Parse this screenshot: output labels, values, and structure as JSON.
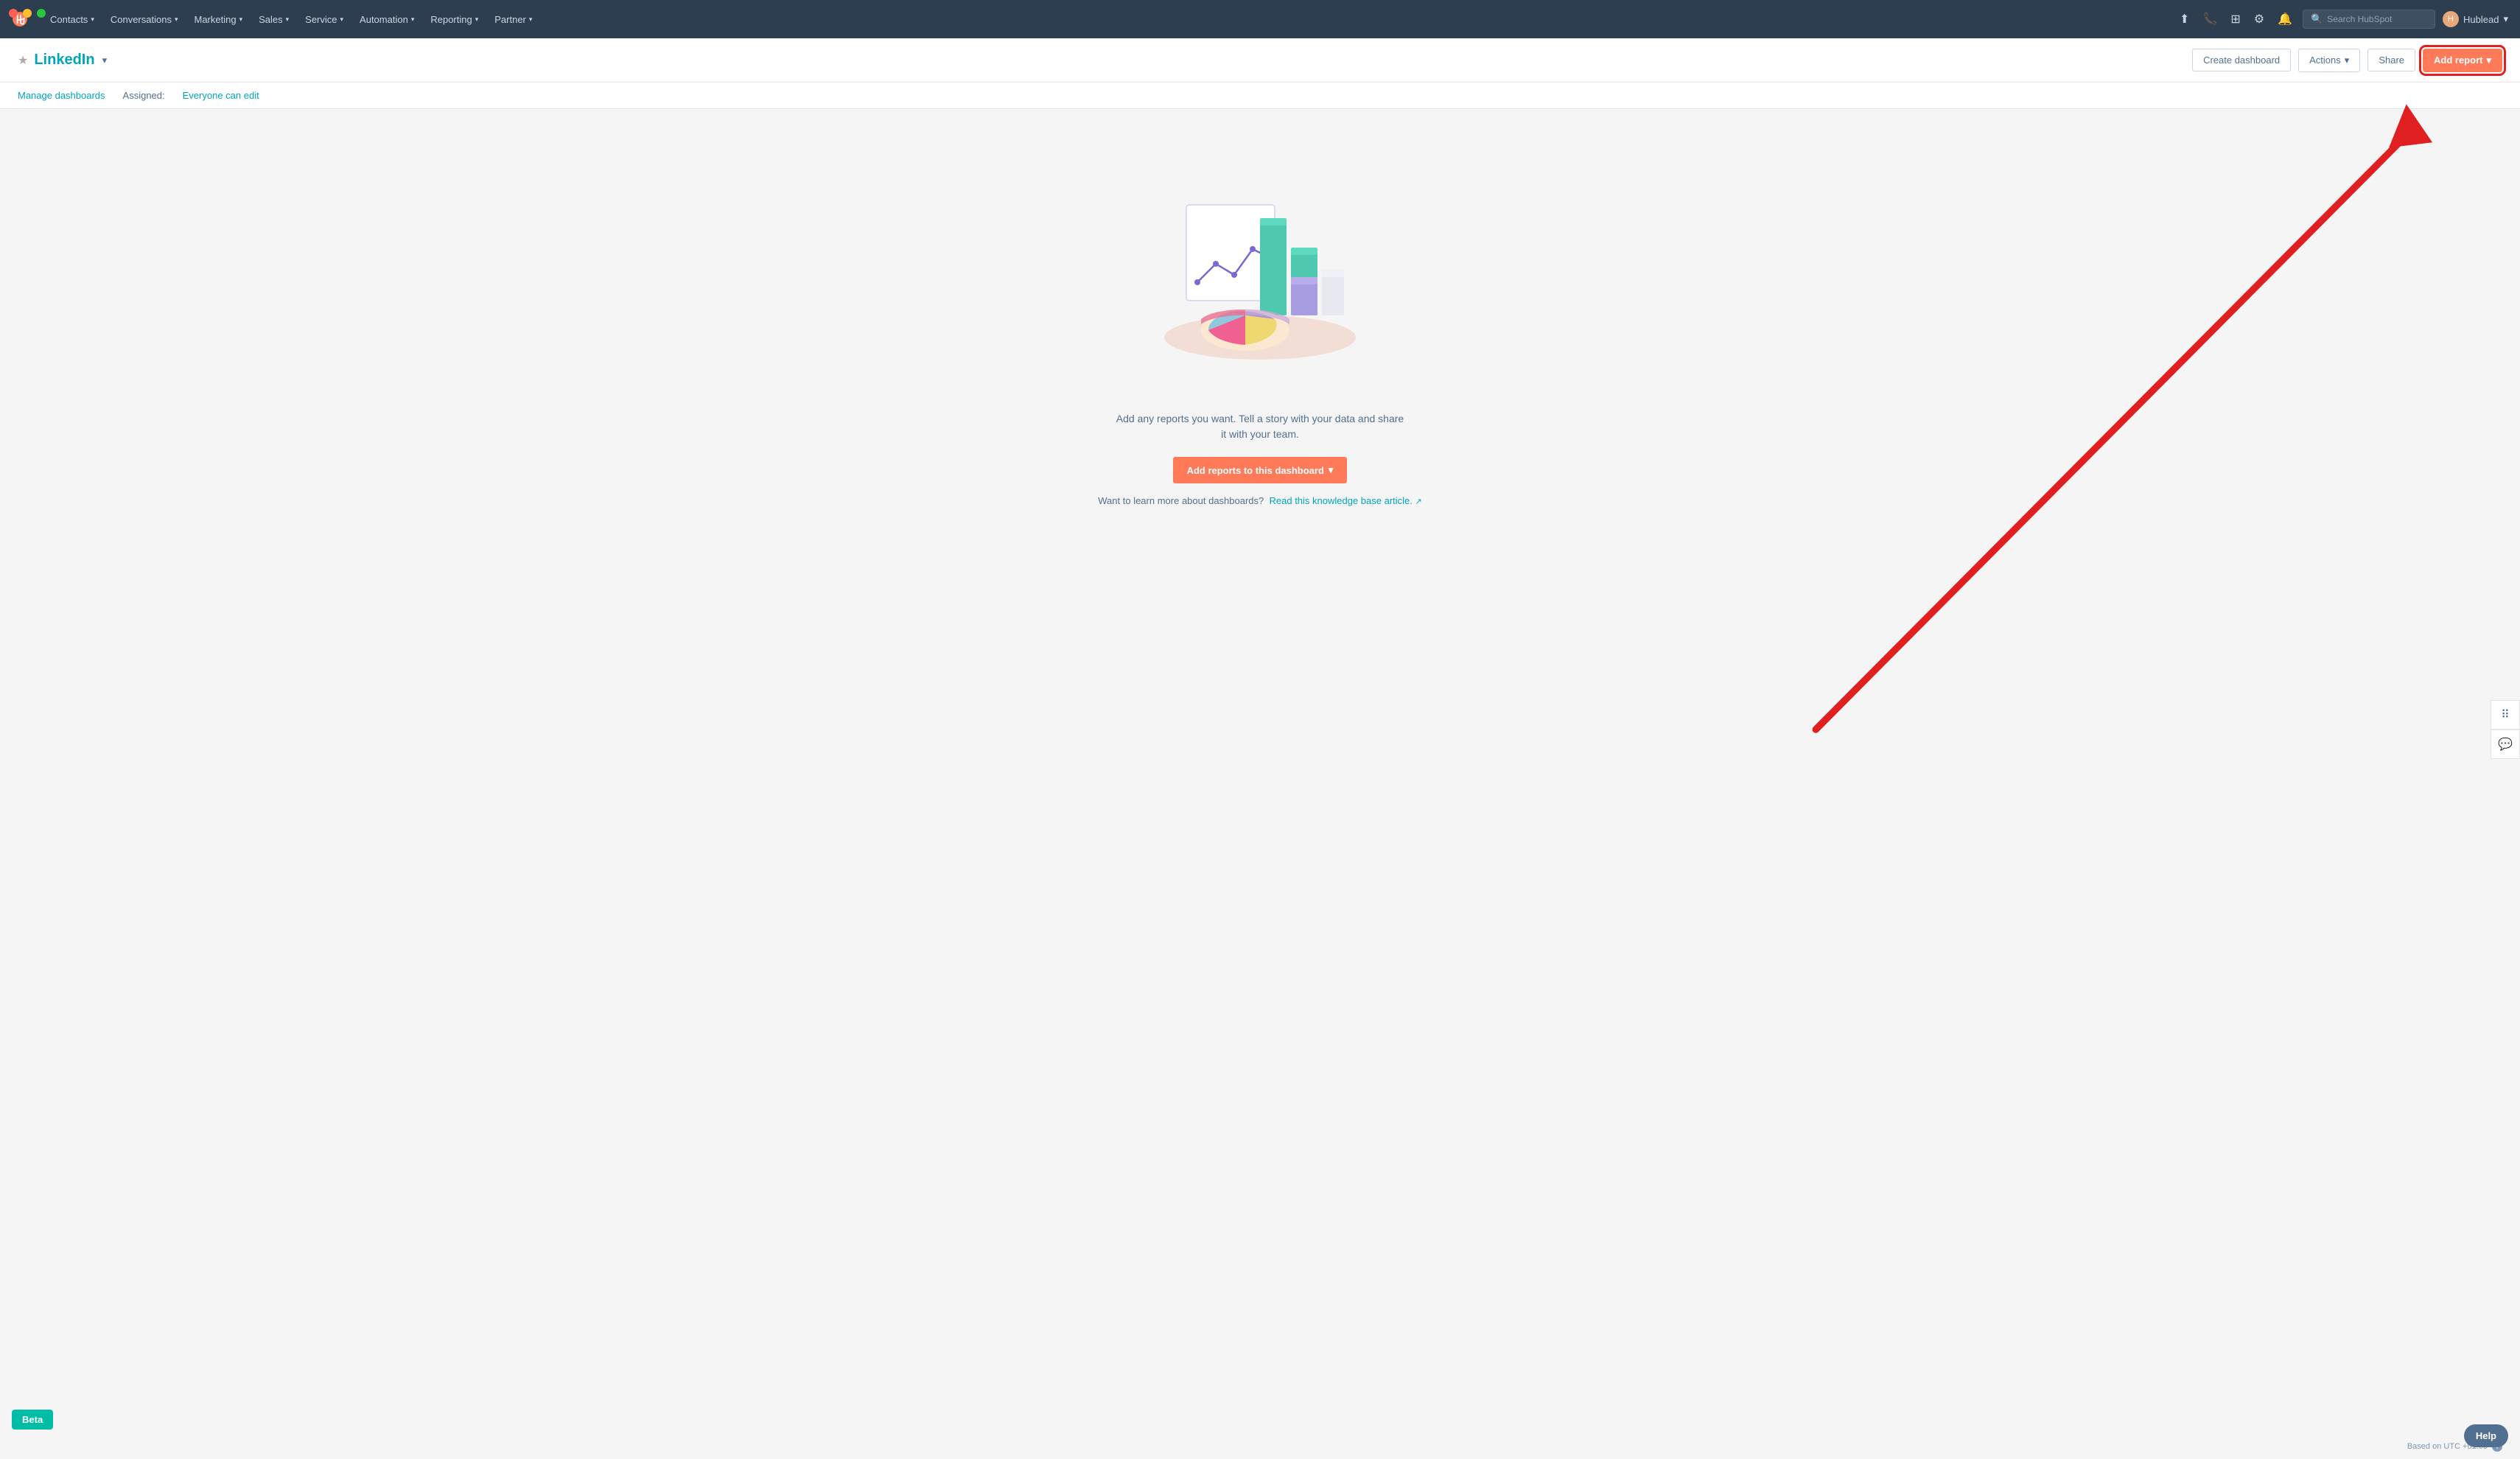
{
  "window_chrome": {
    "dot_red": "red",
    "dot_yellow": "yellow",
    "dot_green": "green"
  },
  "topbar": {
    "logo_symbol": "⚙",
    "nav_items": [
      {
        "label": "Contacts",
        "has_chevron": true
      },
      {
        "label": "Conversations",
        "has_chevron": true
      },
      {
        "label": "Marketing",
        "has_chevron": true
      },
      {
        "label": "Sales",
        "has_chevron": true
      },
      {
        "label": "Service",
        "has_chevron": true
      },
      {
        "label": "Automation",
        "has_chevron": true
      },
      {
        "label": "Reporting",
        "has_chevron": true
      },
      {
        "label": "Partner",
        "has_chevron": true
      }
    ],
    "search_placeholder": "Search HubSpot",
    "icons": [
      "upgrade-icon",
      "phone-icon",
      "grid-icon",
      "settings-icon",
      "bell-icon"
    ],
    "user_label": "Hublead",
    "user_chevron": true
  },
  "subheader": {
    "star_label": "★",
    "dashboard_name": "LinkedIn",
    "dropdown_caret": "▾",
    "buttons": {
      "create_dashboard": "Create dashboard",
      "actions": "Actions",
      "actions_caret": "▾",
      "share": "Share",
      "add_report": "Add report",
      "add_report_caret": "▾"
    }
  },
  "manage_bar": {
    "manage_link": "Manage dashboards",
    "assigned_label": "Assigned:",
    "everyone_label": "Everyone can edit"
  },
  "main": {
    "empty_text": "Add any reports you want. Tell a story with your data and share it with your team.",
    "add_reports_btn": "Add reports to this dashboard",
    "add_reports_caret": "▾",
    "knowledge_prefix": "Want to learn more about dashboards?",
    "knowledge_link": "Read this knowledge base article.",
    "external_icon": "↗"
  },
  "footer": {
    "timezone_label": "Based on UTC +01:00",
    "info_icon": "i"
  },
  "side_float": {
    "grid_icon": "⠿",
    "chat_icon": "💬"
  },
  "badges": {
    "beta": "Beta",
    "help": "Help"
  },
  "colors": {
    "primary_orange": "#ff7a59",
    "teal": "#00a4bd",
    "dark_nav": "#2d3e50",
    "highlight_red": "#e02020"
  }
}
